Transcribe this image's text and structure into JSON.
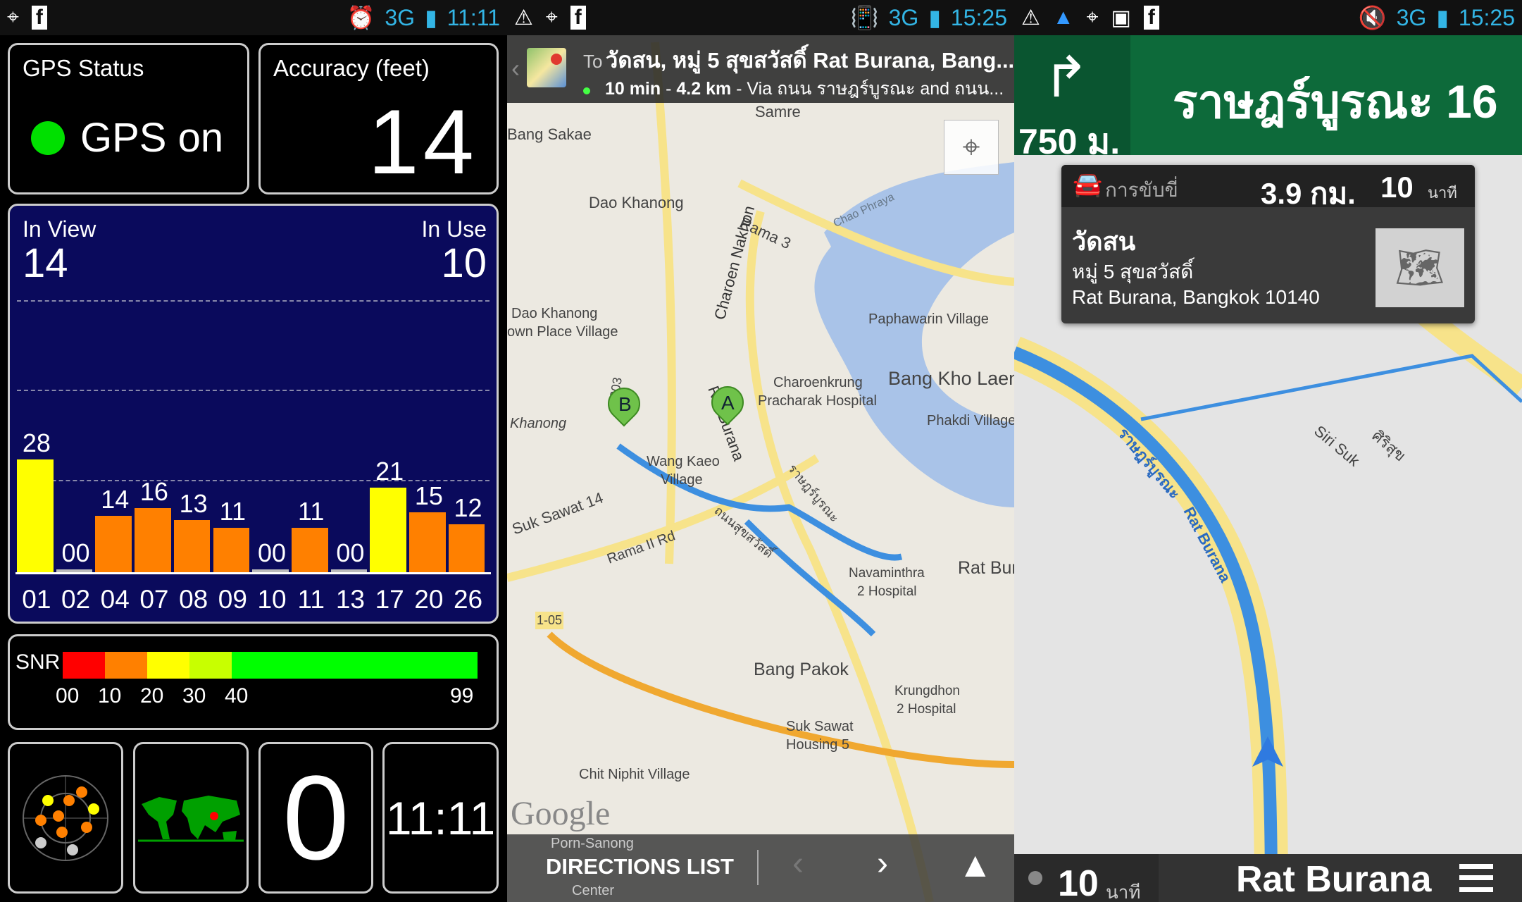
{
  "left": {
    "status": {
      "icons": [
        "gps-icon",
        "facebook-icon",
        "alarm-icon"
      ],
      "network": "3G",
      "time": "11:11"
    },
    "gps_status": {
      "label": "GPS Status",
      "value": "GPS on",
      "color": "#00e000"
    },
    "accuracy": {
      "label": "Accuracy (feet)",
      "value": "14"
    },
    "satellites": {
      "in_view_label": "In View",
      "in_view": "14",
      "in_use_label": "In Use",
      "in_use": "10",
      "chart_data": {
        "type": "bar",
        "categories": [
          "01",
          "02",
          "04",
          "07",
          "08",
          "09",
          "10",
          "11",
          "13",
          "17",
          "20",
          "26"
        ],
        "values": [
          28,
          0,
          14,
          16,
          13,
          11,
          0,
          11,
          0,
          21,
          15,
          12
        ],
        "labels": [
          "28",
          "00",
          "14",
          "16",
          "13",
          "11",
          "00",
          "11",
          "00",
          "21",
          "15",
          "12"
        ],
        "in_use": [
          true,
          false,
          false,
          false,
          false,
          false,
          false,
          false,
          false,
          true,
          false,
          false
        ],
        "colors": {
          "in_use": "#ffff00",
          "not_used": "#ff8000"
        }
      }
    },
    "snr": {
      "label": "SNR",
      "ticks": [
        "00",
        "10",
        "20",
        "30",
        "40",
        "99"
      ],
      "colors": [
        "#ff0000",
        "#ff8000",
        "#ffff00",
        "#c8ff00",
        "#00ff00"
      ]
    },
    "tiles": {
      "count": "0",
      "clock": "11:11"
    }
  },
  "middle": {
    "status": {
      "time": "15:25",
      "network": "3G"
    },
    "header": {
      "to": "To",
      "destination": "วัดสน, หมู่ 5 สุขสวัสดิ์ Rat Burana, Bang...",
      "time": "10 min",
      "sep1": " - ",
      "dist": "4.2 km",
      "via": " - Via ถนน ราษฎร์บูรณะ and ถนน..."
    },
    "map_labels": [
      "Samre",
      "Bang Sakae",
      "Dao Khanong",
      "Rama 3",
      "Chao Phraya",
      "Charoen Nakhon",
      "Dao Khanong",
      "own Place Village",
      "Paphawarin Village",
      "Bang Kho Laem",
      "Charoenkrung",
      "Pracharak Hospital",
      "Phakdi Village",
      "Khanong",
      "Rat Burana",
      "Wang Kaeo",
      "Village",
      "Suk Sawat 14",
      "Rama II Rd",
      "ถนนสุขสวัสดิ์",
      "ราษฎร์บูรณะ",
      "Navaminthra",
      "2 Hospital",
      "Rat Bur",
      "Bang Pakok",
      "Krungdhon",
      "2 Hospital",
      "Suk Sawat",
      "Housing 5",
      "Chit Niphit Village",
      "Porn-Sanong",
      "Center",
      "1-05",
      "303",
      "Google"
    ],
    "markers": {
      "a": "A",
      "b": "B"
    },
    "bottom": {
      "directions": "DIRECTIONS LIST"
    }
  },
  "right": {
    "status": {
      "time": "15:25",
      "network": "3G"
    },
    "turn": {
      "distance": "750 ม.",
      "street": "ราษฎร์บูรณะ 16"
    },
    "card": {
      "mode": "การขับขี่",
      "distance": "3.9 กม.",
      "minutes": "10",
      "min_unit": "นาที",
      "name": "วัดสน",
      "addr1": "หมู่ 5 สุขสวัสดิ์",
      "addr2": "Rat Burana, Bangkok 10140"
    },
    "map_labels": [
      "Rat Burana",
      "ราษฎร์บูรณะ",
      "Siri Suk",
      "ศิริสุข"
    ],
    "bottom": {
      "minutes": "10",
      "unit": "นาที",
      "street": "Rat Burana"
    }
  }
}
